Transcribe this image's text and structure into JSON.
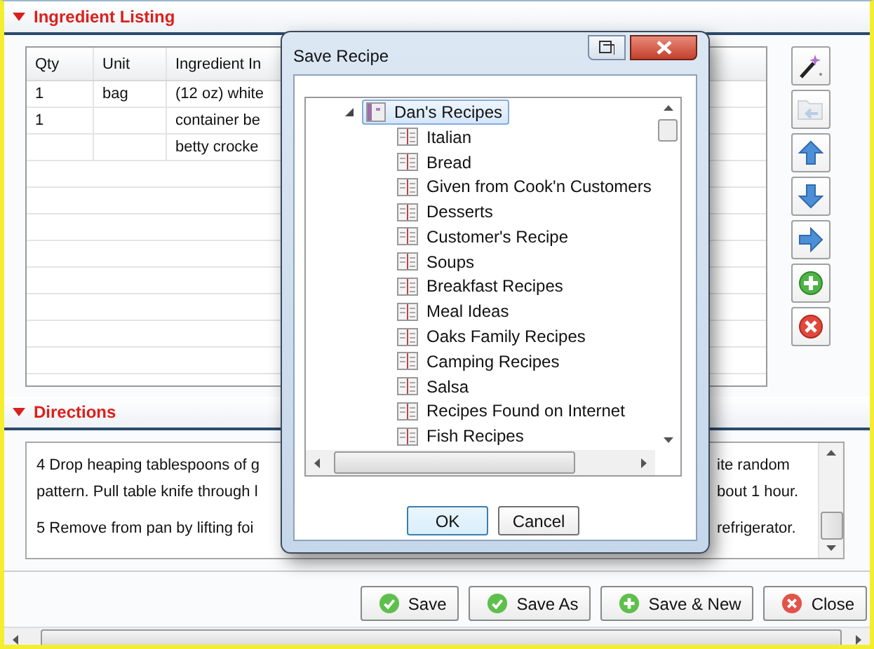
{
  "ingredients": {
    "title": "Ingredient Listing",
    "expanded": true,
    "columns": [
      "Qty",
      "Unit",
      "Ingredient In"
    ],
    "rows": [
      [
        "1",
        "bag",
        "(12 oz) white"
      ],
      [
        "1",
        "",
        "container be"
      ],
      [
        "",
        "",
        "betty crocke"
      ]
    ]
  },
  "toolbar": [
    {
      "kind": "wand",
      "disabled": false
    },
    {
      "kind": "folder",
      "disabled": true
    },
    {
      "kind": "up",
      "disabled": false
    },
    {
      "kind": "down",
      "disabled": false
    },
    {
      "kind": "right",
      "disabled": false
    },
    {
      "kind": "add",
      "disabled": false
    },
    {
      "kind": "remove",
      "disabled": false
    }
  ],
  "directions": {
    "title": "Directions",
    "expanded": true,
    "paragraphs": [
      [
        {
          "left": "4 Drop heaping tablespoons of g",
          "right": "ite random"
        },
        {
          "left": "pattern. Pull table knife through l",
          "right": "bout 1 hour."
        }
      ],
      [
        {
          "left": "5 Remove from pan by lifting foi",
          "right": "refrigerator."
        }
      ]
    ]
  },
  "buttons": [
    {
      "label": "Save",
      "kind": "check"
    },
    {
      "label": "Save As",
      "kind": "check"
    },
    {
      "label": "Save & New",
      "kind": "add"
    },
    {
      "label": "Close",
      "kind": "close"
    }
  ],
  "dialog": {
    "title": "Save Recipe",
    "tree": {
      "label": "Dan's Recipes",
      "selected": true,
      "expanded": true,
      "children": [
        {
          "label": "Italian",
          "selected": false
        },
        {
          "label": "Bread",
          "selected": false
        },
        {
          "label": "Given from Cook'n Customers",
          "selected": false
        },
        {
          "label": "Desserts",
          "selected": false
        },
        {
          "label": "Customer's Recipe",
          "selected": false
        },
        {
          "label": "Soups",
          "selected": false
        },
        {
          "label": "Breakfast Recipes",
          "selected": false
        },
        {
          "label": "Meal Ideas",
          "selected": false
        },
        {
          "label": "Oaks Family Recipes",
          "selected": false
        },
        {
          "label": "Camping Recipes",
          "selected": false
        },
        {
          "label": "Salsa",
          "selected": false
        },
        {
          "label": "Recipes Found on Internet",
          "selected": false
        },
        {
          "label": "Fish Recipes",
          "selected": false
        }
      ]
    },
    "buttons": [
      {
        "label": "OK",
        "default": true
      },
      {
        "label": "Cancel",
        "default": false
      }
    ]
  }
}
